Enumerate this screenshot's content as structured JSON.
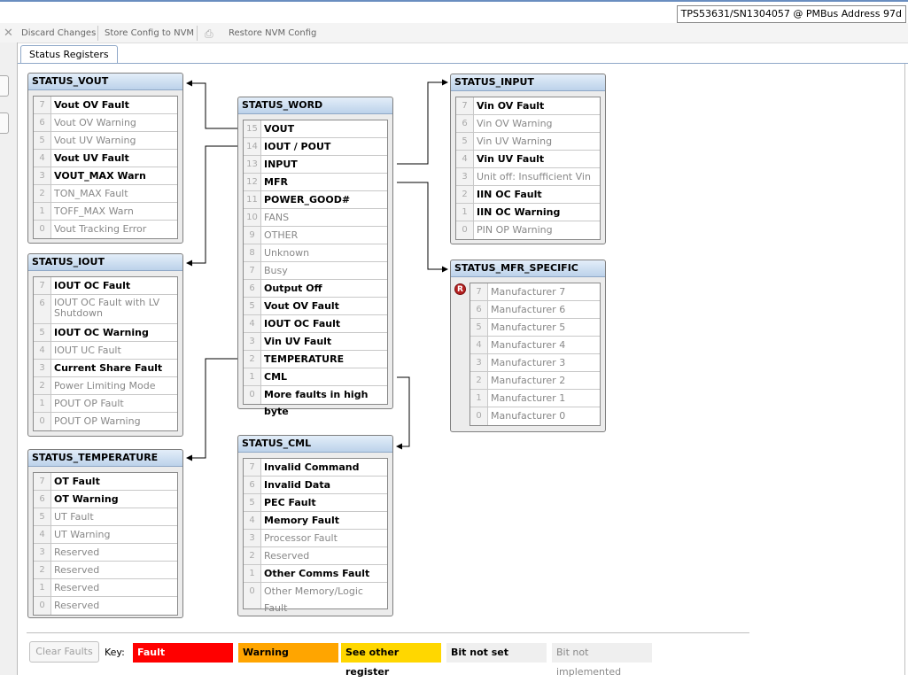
{
  "header": {
    "device": "TPS53631/SN1304057 @ PMBus Address 97d"
  },
  "toolbar": {
    "discard_label": "Discard Changes",
    "store_label": "Store Config to NVM",
    "restore_label": "Restore NVM Config"
  },
  "tabs": [
    {
      "label": "Status Registers"
    }
  ],
  "registers": {
    "vout": {
      "title": "STATUS_VOUT",
      "bits": [
        {
          "n": "7",
          "label": "Vout OV Fault",
          "state": "on"
        },
        {
          "n": "6",
          "label": "Vout OV Warning",
          "state": "off"
        },
        {
          "n": "5",
          "label": "Vout UV Warning",
          "state": "off"
        },
        {
          "n": "4",
          "label": "Vout UV Fault",
          "state": "on"
        },
        {
          "n": "3",
          "label": "VOUT_MAX Warn",
          "state": "on"
        },
        {
          "n": "2",
          "label": "TON_MAX Fault",
          "state": "off"
        },
        {
          "n": "1",
          "label": "TOFF_MAX Warn",
          "state": "off"
        },
        {
          "n": "0",
          "label": "Vout Tracking Error",
          "state": "off"
        }
      ]
    },
    "iout": {
      "title": "STATUS_IOUT",
      "bits": [
        {
          "n": "7",
          "label": "IOUT OC Fault",
          "state": "on"
        },
        {
          "n": "6",
          "label": "IOUT OC Fault with LV Shutdown",
          "state": "off",
          "tall": true
        },
        {
          "n": "5",
          "label": "IOUT OC Warning",
          "state": "on"
        },
        {
          "n": "4",
          "label": "IOUT UC Fault",
          "state": "off"
        },
        {
          "n": "3",
          "label": "Current Share Fault",
          "state": "on"
        },
        {
          "n": "2",
          "label": "Power Limiting Mode",
          "state": "off"
        },
        {
          "n": "1",
          "label": "POUT OP Fault",
          "state": "off"
        },
        {
          "n": "0",
          "label": "POUT OP Warning",
          "state": "off"
        }
      ]
    },
    "temperature": {
      "title": "STATUS_TEMPERATURE",
      "bits": [
        {
          "n": "7",
          "label": "OT Fault",
          "state": "on"
        },
        {
          "n": "6",
          "label": "OT Warning",
          "state": "on"
        },
        {
          "n": "5",
          "label": "UT Fault",
          "state": "off"
        },
        {
          "n": "4",
          "label": "UT Warning",
          "state": "off"
        },
        {
          "n": "3",
          "label": "Reserved",
          "state": "off"
        },
        {
          "n": "2",
          "label": "Reserved",
          "state": "off"
        },
        {
          "n": "1",
          "label": "Reserved",
          "state": "off"
        },
        {
          "n": "0",
          "label": "Reserved",
          "state": "off"
        }
      ]
    },
    "word": {
      "title": "STATUS_WORD",
      "bits": [
        {
          "n": "15",
          "label": "VOUT",
          "state": "on"
        },
        {
          "n": "14",
          "label": "IOUT / POUT",
          "state": "on"
        },
        {
          "n": "13",
          "label": "INPUT",
          "state": "on"
        },
        {
          "n": "12",
          "label": "MFR",
          "state": "on"
        },
        {
          "n": "11",
          "label": "POWER_GOOD#",
          "state": "on"
        },
        {
          "n": "10",
          "label": "FANS",
          "state": "off"
        },
        {
          "n": "9",
          "label": "OTHER",
          "state": "off"
        },
        {
          "n": "8",
          "label": "Unknown",
          "state": "off"
        },
        {
          "n": "7",
          "label": "Busy",
          "state": "off"
        },
        {
          "n": "6",
          "label": "Output Off",
          "state": "on"
        },
        {
          "n": "5",
          "label": "Vout OV Fault",
          "state": "on"
        },
        {
          "n": "4",
          "label": "IOUT OC Fault",
          "state": "on"
        },
        {
          "n": "3",
          "label": "Vin UV Fault",
          "state": "on"
        },
        {
          "n": "2",
          "label": "TEMPERATURE",
          "state": "on"
        },
        {
          "n": "1",
          "label": "CML",
          "state": "on"
        },
        {
          "n": "0",
          "label": "More faults in high byte",
          "state": "on"
        }
      ]
    },
    "cml": {
      "title": "STATUS_CML",
      "bits": [
        {
          "n": "7",
          "label": "Invalid Command",
          "state": "on"
        },
        {
          "n": "6",
          "label": "Invalid Data",
          "state": "on"
        },
        {
          "n": "5",
          "label": "PEC Fault",
          "state": "on"
        },
        {
          "n": "4",
          "label": "Memory Fault",
          "state": "on"
        },
        {
          "n": "3",
          "label": "Processor Fault",
          "state": "off"
        },
        {
          "n": "2",
          "label": "Reserved",
          "state": "off"
        },
        {
          "n": "1",
          "label": "Other Comms Fault",
          "state": "on"
        },
        {
          "n": "0",
          "label": "Other Memory/Logic Fault",
          "state": "off"
        }
      ]
    },
    "input": {
      "title": "STATUS_INPUT",
      "bits": [
        {
          "n": "7",
          "label": "Vin OV Fault",
          "state": "on"
        },
        {
          "n": "6",
          "label": "Vin OV Warning",
          "state": "off"
        },
        {
          "n": "5",
          "label": "Vin UV Warning",
          "state": "off"
        },
        {
          "n": "4",
          "label": "Vin UV Fault",
          "state": "on"
        },
        {
          "n": "3",
          "label": "Unit off: Insufficient Vin",
          "state": "off"
        },
        {
          "n": "2",
          "label": "IIN OC Fault",
          "state": "on"
        },
        {
          "n": "1",
          "label": "IIN OC Warning",
          "state": "on"
        },
        {
          "n": "0",
          "label": "PIN OP Warning",
          "state": "off"
        }
      ]
    },
    "mfr": {
      "title": "STATUS_MFR_SPECIFIC",
      "marker": "R",
      "bits": [
        {
          "n": "7",
          "label": "Manufacturer 7",
          "state": "off"
        },
        {
          "n": "6",
          "label": "Manufacturer 6",
          "state": "off"
        },
        {
          "n": "5",
          "label": "Manufacturer 5",
          "state": "off"
        },
        {
          "n": "4",
          "label": "Manufacturer 4",
          "state": "off"
        },
        {
          "n": "3",
          "label": "Manufacturer 3",
          "state": "off"
        },
        {
          "n": "2",
          "label": "Manufacturer 2",
          "state": "off"
        },
        {
          "n": "1",
          "label": "Manufacturer 1",
          "state": "off"
        },
        {
          "n": "0",
          "label": "Manufacturer 0",
          "state": "off"
        }
      ]
    }
  },
  "footer": {
    "clear_label": "Clear Faults",
    "key_label": "Key:",
    "keys": [
      {
        "label": "Fault",
        "bg": "#ff0000",
        "fg": "#ffffff"
      },
      {
        "label": "Warning",
        "bg": "#ffa500",
        "fg": "#000000"
      },
      {
        "label": "See other register",
        "bg": "#ffd700",
        "fg": "#000000"
      },
      {
        "label": "Bit not set",
        "bg": "#efefef",
        "fg": "#000000"
      },
      {
        "label": "Bit not implemented",
        "bg": "#efefef",
        "fg": "#888888"
      }
    ]
  }
}
